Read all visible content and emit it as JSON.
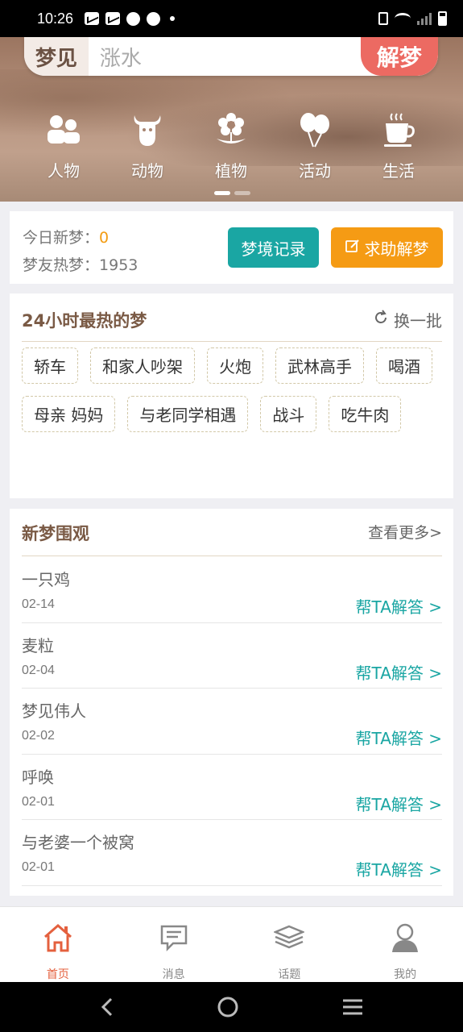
{
  "status_bar": {
    "time": "10:26"
  },
  "search": {
    "tag": "梦见",
    "value": "涨水",
    "button": "解梦"
  },
  "categories": [
    {
      "label": "人物",
      "icon": "people-icon"
    },
    {
      "label": "动物",
      "icon": "cow-icon"
    },
    {
      "label": "植物",
      "icon": "flower-icon"
    },
    {
      "label": "活动",
      "icon": "balloons-icon"
    },
    {
      "label": "生活",
      "icon": "coffee-cup-icon"
    }
  ],
  "stats": {
    "today_label": "今日新梦：",
    "today_value": "0",
    "hot_label": "梦友热梦：",
    "hot_value": "1953",
    "record_button": "梦境记录",
    "help_button": "求助解梦"
  },
  "hot_dreams": {
    "title": "24小时最热的梦",
    "refresh": "换一批",
    "tags": [
      "轿车",
      "和家人吵架",
      "火炮",
      "武林高手",
      "喝酒",
      "母亲 妈妈",
      "与老同学相遇",
      "战斗",
      "吃牛肉"
    ]
  },
  "new_dreams": {
    "title": "新梦围观",
    "more": "查看更多>",
    "items": [
      {
        "title": "一只鸡",
        "date": "02-14",
        "action": "帮TA解答 >"
      },
      {
        "title": "麦粒",
        "date": "02-04",
        "action": "帮TA解答 >"
      },
      {
        "title": "梦见伟人",
        "date": "02-02",
        "action": "帮TA解答 >"
      },
      {
        "title": "呼唤",
        "date": "02-01",
        "action": "帮TA解答 >"
      },
      {
        "title": "与老婆一个被窝",
        "date": "02-01",
        "action": "帮TA解答 >"
      }
    ]
  },
  "tabs": [
    {
      "label": "首页",
      "icon": "home-icon",
      "active": true
    },
    {
      "label": "消息",
      "icon": "message-icon",
      "active": false
    },
    {
      "label": "话题",
      "icon": "layers-icon",
      "active": false
    },
    {
      "label": "我的",
      "icon": "user-icon",
      "active": false
    }
  ],
  "colors": {
    "teal": "#1aa6a3",
    "orange": "#f59b14",
    "red": "#ec6a62",
    "active_tab": "#e4603e"
  }
}
